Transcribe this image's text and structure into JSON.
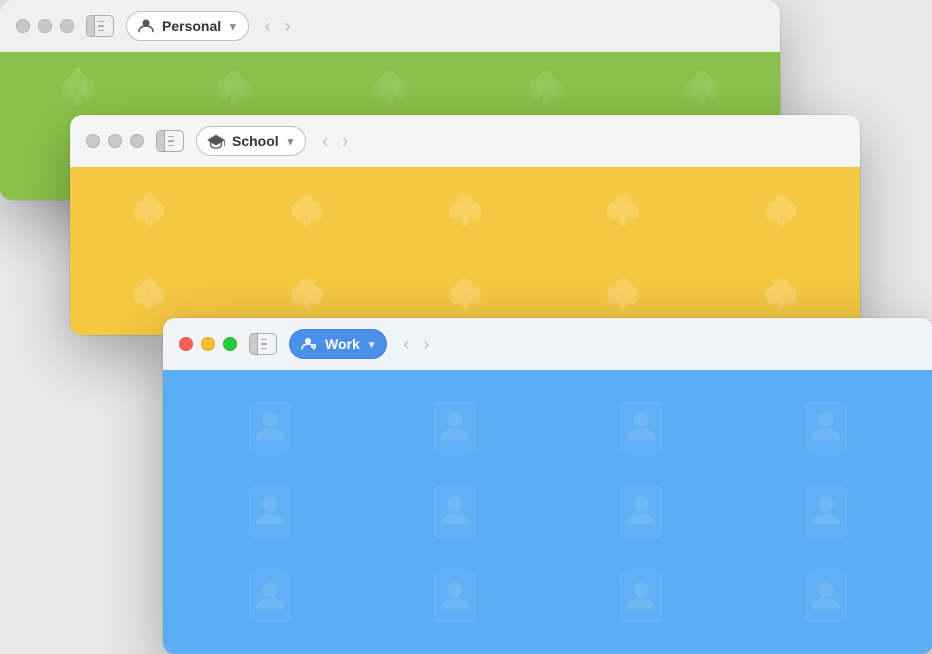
{
  "windows": {
    "personal": {
      "title": "Personal",
      "state": "inactive",
      "icon": "person-icon",
      "chevron": "▾",
      "nav_back": "‹",
      "nav_forward": "›",
      "sidebar_toggle_label": "sidebar-toggle",
      "background_color": "#8bc34a"
    },
    "school": {
      "title": "School",
      "state": "inactive",
      "icon": "graduation-cap-icon",
      "chevron": "▾",
      "nav_back": "‹",
      "nav_forward": "›",
      "sidebar_toggle_label": "sidebar-toggle",
      "background_color": "#f5c842"
    },
    "work": {
      "title": "Work",
      "state": "active",
      "icon": "person-badge-icon",
      "chevron": "▾",
      "nav_back": "‹",
      "nav_forward": "›",
      "sidebar_toggle_label": "sidebar-toggle",
      "background_color": "#5aacf5"
    }
  },
  "traffic_lights": {
    "close_label": "Close",
    "minimize_label": "Minimize",
    "maximize_label": "Maximize"
  }
}
